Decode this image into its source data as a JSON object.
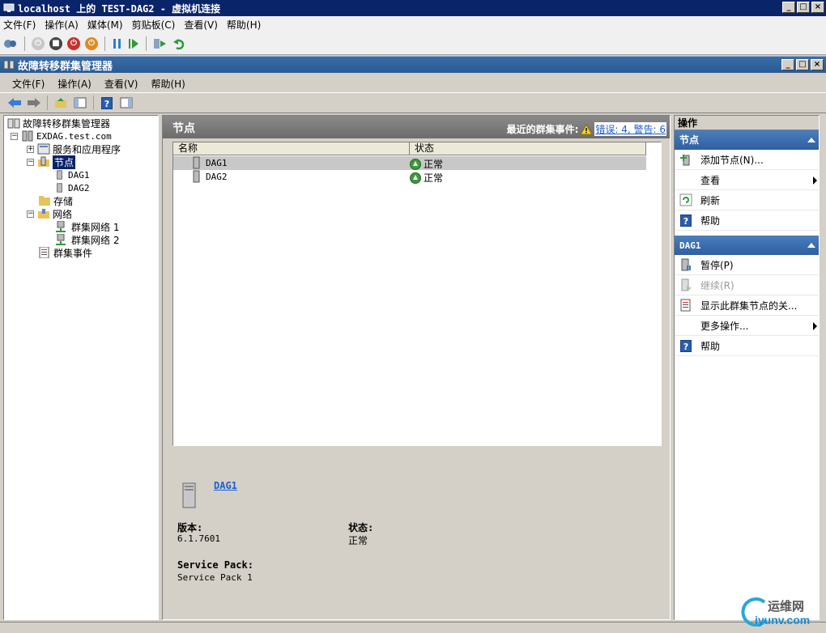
{
  "vm_window": {
    "title": "localhost 上的 TEST-DAG2 - 虚拟机连接",
    "menu": [
      "文件(F)",
      "操作(A)",
      "媒体(M)",
      "剪贴板(C)",
      "查看(V)",
      "帮助(H)"
    ]
  },
  "mmc_window": {
    "title": "故障转移群集管理器",
    "menu": [
      "文件(F)",
      "操作(A)",
      "查看(V)",
      "帮助(H)"
    ]
  },
  "tree": {
    "root": "故障转移群集管理器",
    "cluster": "EXDAG.test.com",
    "services": "服务和应用程序",
    "nodes": "节点",
    "node1": "DAG1",
    "node2": "DAG2",
    "storage": "存储",
    "networks": "网络",
    "network1": "群集网络 1",
    "network2": "群集网络 2",
    "events": "群集事件"
  },
  "center": {
    "title": "节点",
    "events_label": "最近的群集事件:",
    "events_link": "错误: 4, 警告: 6",
    "columns": [
      "名称",
      "状态"
    ],
    "rows": [
      {
        "name": "DAG1",
        "status": "正常"
      },
      {
        "name": "DAG2",
        "status": "正常"
      }
    ],
    "detail": {
      "name": "DAG1",
      "version_label": "版本:",
      "version_value": "6.1.7601",
      "status_label": "状态:",
      "status_value": "正常",
      "sp_label": "Service Pack:",
      "sp_value": "Service Pack 1"
    }
  },
  "actions": {
    "title": "操作",
    "section1": "节点",
    "section1_items": [
      "添加节点(N)...",
      "查看",
      "刷新",
      "帮助"
    ],
    "section2": "DAG1",
    "section2_items": [
      "暂停(P)",
      "继续(R)",
      "显示此群集节点的关...",
      "更多操作...",
      "帮助"
    ]
  },
  "watermark": {
    "text": "运维网",
    "url": "iyunv.com"
  }
}
